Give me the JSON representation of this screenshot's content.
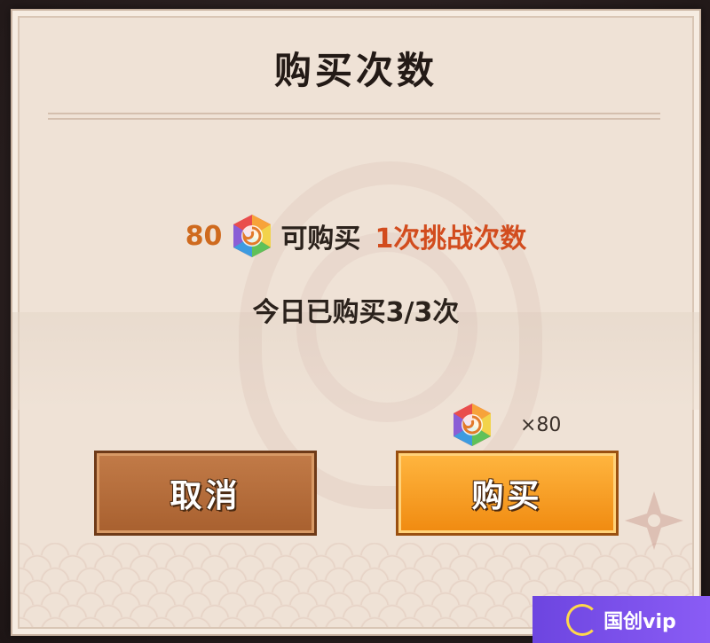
{
  "dialog": {
    "title": "购买次数",
    "cost_amount": "80",
    "cost_label": "可购买",
    "reward_text": "1次挑战次数",
    "daily_status": "今日已购买3/3次",
    "price_quantity": "×80"
  },
  "buttons": {
    "cancel_label": "取消",
    "buy_label": "购买"
  },
  "watermark": {
    "label": "国创vip"
  },
  "icons": {
    "gem": "rainbow-hexagon-gem-icon",
    "shuriken": "shuriken-icon"
  },
  "colors": {
    "panel_bg": "#efe2d6",
    "cost_orange": "#cf6a1e",
    "reward_red": "#d24c1e",
    "cancel_button": "#b56a3a",
    "buy_button": "#f59a20"
  }
}
